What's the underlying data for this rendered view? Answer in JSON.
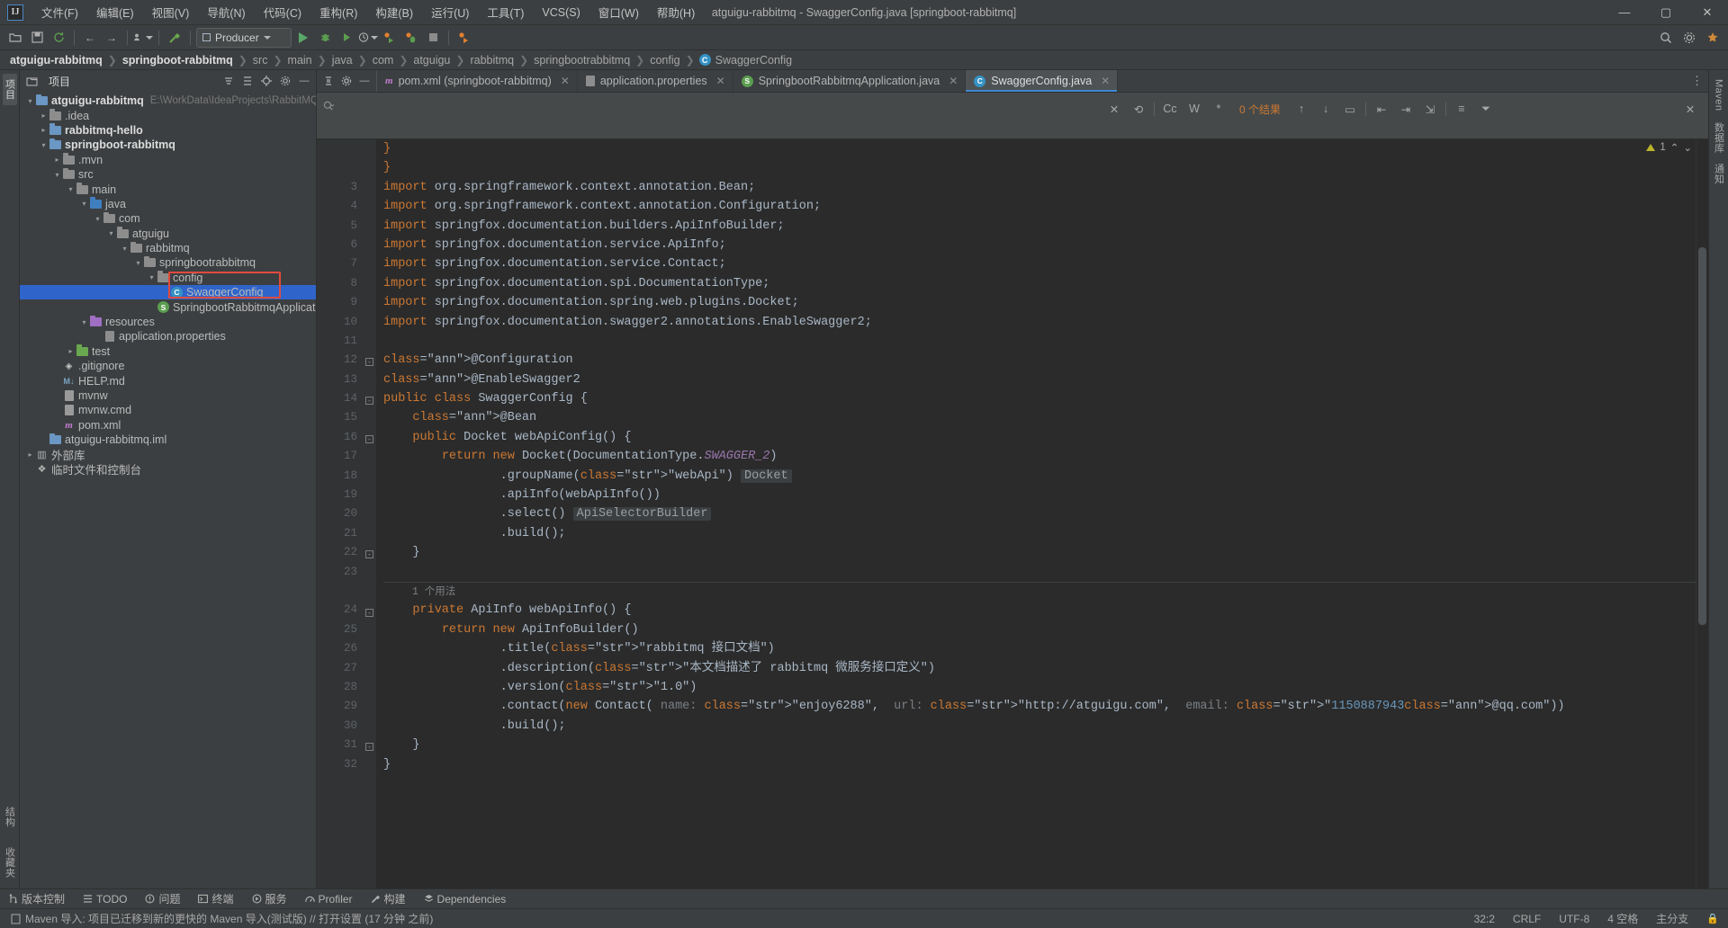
{
  "window": {
    "title": "atguigu-rabbitmq - SwaggerConfig.java [springboot-rabbitmq]",
    "minimize": "—",
    "maximize": "▢",
    "close": "✕"
  },
  "menu": [
    {
      "label": "文件(F)"
    },
    {
      "label": "编辑(E)"
    },
    {
      "label": "视图(V)"
    },
    {
      "label": "导航(N)"
    },
    {
      "label": "代码(C)"
    },
    {
      "label": "重构(R)"
    },
    {
      "label": "构建(B)"
    },
    {
      "label": "运行(U)"
    },
    {
      "label": "工具(T)"
    },
    {
      "label": "VCS(S)"
    },
    {
      "label": "窗口(W)"
    },
    {
      "label": "帮助(H)"
    }
  ],
  "toolbar": {
    "run_config": "Producer",
    "icons": [
      "open-folder-icon",
      "save-all-icon",
      "sync-icon",
      "back-icon",
      "forward-icon",
      "profile-icon",
      "build-hammer-icon"
    ],
    "right_icons": [
      "search-everywhere-icon",
      "settings-icon",
      "notifications-icon"
    ]
  },
  "breadcrumb": [
    {
      "label": "atguigu-rabbitmq",
      "bold": true
    },
    {
      "label": "springboot-rabbitmq",
      "bold": true
    },
    {
      "label": "src",
      "bold": false
    },
    {
      "label": "main",
      "bold": false
    },
    {
      "label": "java",
      "bold": false
    },
    {
      "label": "com",
      "bold": false
    },
    {
      "label": "atguigu",
      "bold": false
    },
    {
      "label": "rabbitmq",
      "bold": false
    },
    {
      "label": "springbootrabbitmq",
      "bold": false
    },
    {
      "label": "config",
      "bold": false
    },
    {
      "label": "SwaggerConfig",
      "bold": false,
      "badge": "C"
    }
  ],
  "project_panel": {
    "title": "项目",
    "header_icons": [
      "collapse-all-icon",
      "expand-icon",
      "locate-icon",
      "settings-icon",
      "hide-icon"
    ],
    "tree": [
      {
        "indent": 0,
        "arrow": "▾",
        "icon": "module",
        "label": "atguigu-rabbitmq",
        "bold": true,
        "sub": "E:\\WorkData\\IdeaProjects\\RabbitMQ\\at"
      },
      {
        "indent": 1,
        "arrow": "▸",
        "icon": "folder",
        "label": ".idea",
        "bold": false,
        "sub": ""
      },
      {
        "indent": 1,
        "arrow": "▸",
        "icon": "module",
        "label": "rabbitmq-hello",
        "bold": true,
        "sub": ""
      },
      {
        "indent": 1,
        "arrow": "▾",
        "icon": "module",
        "label": "springboot-rabbitmq",
        "bold": true,
        "sub": ""
      },
      {
        "indent": 2,
        "arrow": "▸",
        "icon": "folder",
        "label": ".mvn",
        "bold": false,
        "sub": ""
      },
      {
        "indent": 2,
        "arrow": "▾",
        "icon": "folder",
        "label": "src",
        "bold": false,
        "sub": ""
      },
      {
        "indent": 3,
        "arrow": "▾",
        "icon": "folder",
        "label": "main",
        "bold": false,
        "sub": ""
      },
      {
        "indent": 4,
        "arrow": "▾",
        "icon": "source-folder",
        "label": "java",
        "bold": false,
        "sub": ""
      },
      {
        "indent": 5,
        "arrow": "▾",
        "icon": "folder",
        "label": "com",
        "bold": false,
        "sub": ""
      },
      {
        "indent": 6,
        "arrow": "▾",
        "icon": "folder",
        "label": "atguigu",
        "bold": false,
        "sub": ""
      },
      {
        "indent": 7,
        "arrow": "▾",
        "icon": "folder",
        "label": "rabbitmq",
        "bold": false,
        "sub": ""
      },
      {
        "indent": 8,
        "arrow": "▾",
        "icon": "folder",
        "label": "springbootrabbitmq",
        "bold": false,
        "sub": ""
      },
      {
        "indent": 9,
        "arrow": "▾",
        "icon": "folder",
        "label": "config",
        "bold": false,
        "sub": ""
      },
      {
        "indent": 10,
        "arrow": "",
        "icon": "class",
        "label": "SwaggerConfig",
        "bold": false,
        "sub": "",
        "selected": true
      },
      {
        "indent": 9,
        "arrow": "",
        "icon": "spring-class",
        "label": "SpringbootRabbitmqApplication",
        "bold": false,
        "sub": ""
      },
      {
        "indent": 4,
        "arrow": "▾",
        "icon": "resource-folder",
        "label": "resources",
        "bold": false,
        "sub": ""
      },
      {
        "indent": 5,
        "arrow": "",
        "icon": "properties",
        "label": "application.properties",
        "bold": false,
        "sub": ""
      },
      {
        "indent": 3,
        "arrow": "▸",
        "icon": "test-folder",
        "label": "test",
        "bold": false,
        "sub": ""
      },
      {
        "indent": 2,
        "arrow": "",
        "icon": "git",
        "label": ".gitignore",
        "bold": false,
        "sub": ""
      },
      {
        "indent": 2,
        "arrow": "",
        "icon": "md",
        "label": "HELP.md",
        "bold": false,
        "sub": ""
      },
      {
        "indent": 2,
        "arrow": "",
        "icon": "file",
        "label": "mvnw",
        "bold": false,
        "sub": ""
      },
      {
        "indent": 2,
        "arrow": "",
        "icon": "file",
        "label": "mvnw.cmd",
        "bold": false,
        "sub": ""
      },
      {
        "indent": 2,
        "arrow": "",
        "icon": "xml",
        "label": "pom.xml",
        "bold": false,
        "sub": ""
      },
      {
        "indent": 1,
        "arrow": "",
        "icon": "iml",
        "label": "atguigu-rabbitmq.iml",
        "bold": false,
        "sub": ""
      },
      {
        "indent": 0,
        "arrow": "▸",
        "icon": "library",
        "label": "外部库",
        "bold": false,
        "sub": ""
      },
      {
        "indent": 0,
        "arrow": "",
        "icon": "console",
        "label": "临时文件和控制台",
        "bold": false,
        "sub": ""
      }
    ]
  },
  "tabs": [
    {
      "label": "pom.xml (springboot-rabbitmq)",
      "icon": "maven-icon",
      "active": false
    },
    {
      "label": "application.properties",
      "icon": "properties-icon",
      "active": false
    },
    {
      "label": "SpringbootRabbitmqApplication.java",
      "icon": "spring-class-icon",
      "active": false
    },
    {
      "label": "SwaggerConfig.java",
      "icon": "class-icon",
      "active": true
    }
  ],
  "search": {
    "value": "",
    "placeholder": "",
    "result_count": "0 个结果",
    "buttons": [
      "close-icon",
      "restore-icon",
      "match-case-Cc",
      "words-W",
      "regex-star",
      "prev-icon",
      "next-icon",
      "select-all-icon",
      "filter-icon"
    ],
    "labels": {
      "match_case": "Cc",
      "words": "W",
      "regex": "*"
    }
  },
  "inspection": {
    "warning_count": "1",
    "up": "⌃",
    "down": "⌄"
  },
  "code": {
    "first_visible_lines": [
      "}",
      "}"
    ],
    "lines": [
      {
        "num": "3",
        "text": "import org.springframework.context.annotation.Bean;"
      },
      {
        "num": "4",
        "text": "import org.springframework.context.annotation.Configuration;"
      },
      {
        "num": "5",
        "text": "import springfox.documentation.builders.ApiInfoBuilder;"
      },
      {
        "num": "6",
        "text": "import springfox.documentation.service.ApiInfo;"
      },
      {
        "num": "7",
        "text": "import springfox.documentation.service.Contact;"
      },
      {
        "num": "8",
        "text": "import springfox.documentation.spi.DocumentationType;"
      },
      {
        "num": "9",
        "text": "import springfox.documentation.spring.web.plugins.Docket;"
      },
      {
        "num": "10",
        "text": "import springfox.documentation.swagger2.annotations.EnableSwagger2;"
      },
      {
        "num": "11",
        "text": ""
      },
      {
        "num": "12",
        "text": "@Configuration"
      },
      {
        "num": "13",
        "text": "@EnableSwagger2"
      },
      {
        "num": "14",
        "text": "public class SwaggerConfig {"
      },
      {
        "num": "15",
        "text": "    @Bean"
      },
      {
        "num": "16",
        "text": "    public Docket webApiConfig() {"
      },
      {
        "num": "17",
        "text": "        return new Docket(DocumentationType.SWAGGER_2)"
      },
      {
        "num": "18",
        "text": "                .groupName(\"webApi\")  Docket"
      },
      {
        "num": "19",
        "text": "                .apiInfo(webApiInfo())"
      },
      {
        "num": "20",
        "text": "                .select()  ApiSelectorBuilder"
      },
      {
        "num": "21",
        "text": "                .build();"
      },
      {
        "num": "22",
        "text": "    }"
      },
      {
        "num": "23",
        "text": ""
      },
      {
        "num": "24",
        "text": "    private ApiInfo webApiInfo() {"
      },
      {
        "num": "25",
        "text": "        return new ApiInfoBuilder()"
      },
      {
        "num": "26",
        "text": "                .title(\"rabbitmq 接口文档\")"
      },
      {
        "num": "27",
        "text": "                .description(\"本文档描述了 rabbitmq 微服务接口定义\")"
      },
      {
        "num": "28",
        "text": "                .version(\"1.0\")"
      },
      {
        "num": "29",
        "text": "                .contact(new Contact( name: \"enjoy6288\",  url: \"http://atguigu.com\",  email: \"1150887943@qq.com\"))"
      },
      {
        "num": "30",
        "text": "                .build();"
      },
      {
        "num": "31",
        "text": "    }"
      },
      {
        "num": "32",
        "text": "}"
      }
    ],
    "usage_hint": "1 个用法",
    "inlay_hints": {
      "docket": "Docket",
      "api_selector_builder": "ApiSelectorBuilder",
      "name": "name:",
      "url": "url:",
      "email": "email:"
    }
  },
  "tool_window_bar": [
    {
      "label": "版本控制",
      "icon": "vcs-icon"
    },
    {
      "label": "TODO",
      "icon": "todo-icon"
    },
    {
      "label": "问题",
      "icon": "problems-icon"
    },
    {
      "label": "终端",
      "icon": "terminal-icon"
    },
    {
      "label": "服务",
      "icon": "services-icon"
    },
    {
      "label": "Profiler",
      "icon": "profiler-icon"
    },
    {
      "label": "构建",
      "icon": "build-icon"
    },
    {
      "label": "Dependencies",
      "icon": "dependencies-icon"
    }
  ],
  "left_rail": [
    {
      "label": "结构",
      "icon": "structure-icon"
    },
    {
      "label": "收藏夹",
      "icon": "bookmarks-icon"
    }
  ],
  "right_rail": [
    {
      "label": "Maven",
      "icon": "maven-icon"
    },
    {
      "label": "数据库",
      "icon": "database-icon"
    },
    {
      "label": "通知",
      "icon": "notifications-icon"
    }
  ],
  "status_bar": {
    "message": "Maven 导入: 项目已迁移到新的更快的 Maven 导入(测试版) // 打开设置 (17 分钟 之前)",
    "caret": "32:2",
    "line_sep": "CRLF",
    "encoding": "UTF-8",
    "indent": "4 空格",
    "branch": "主分支",
    "lock": "lock-icon"
  },
  "colors": {
    "accent": "#3d87d4",
    "selection": "#2f65ca",
    "highlight_box": "#e04a3f",
    "keyword": "#cc7832",
    "string": "#6a8759",
    "annotation": "#bbb529",
    "number": "#6897bb",
    "link": "#589df6",
    "static_field": "#9876aa",
    "bg_editor": "#2b2b2b",
    "bg_panel": "#3c3f41"
  }
}
